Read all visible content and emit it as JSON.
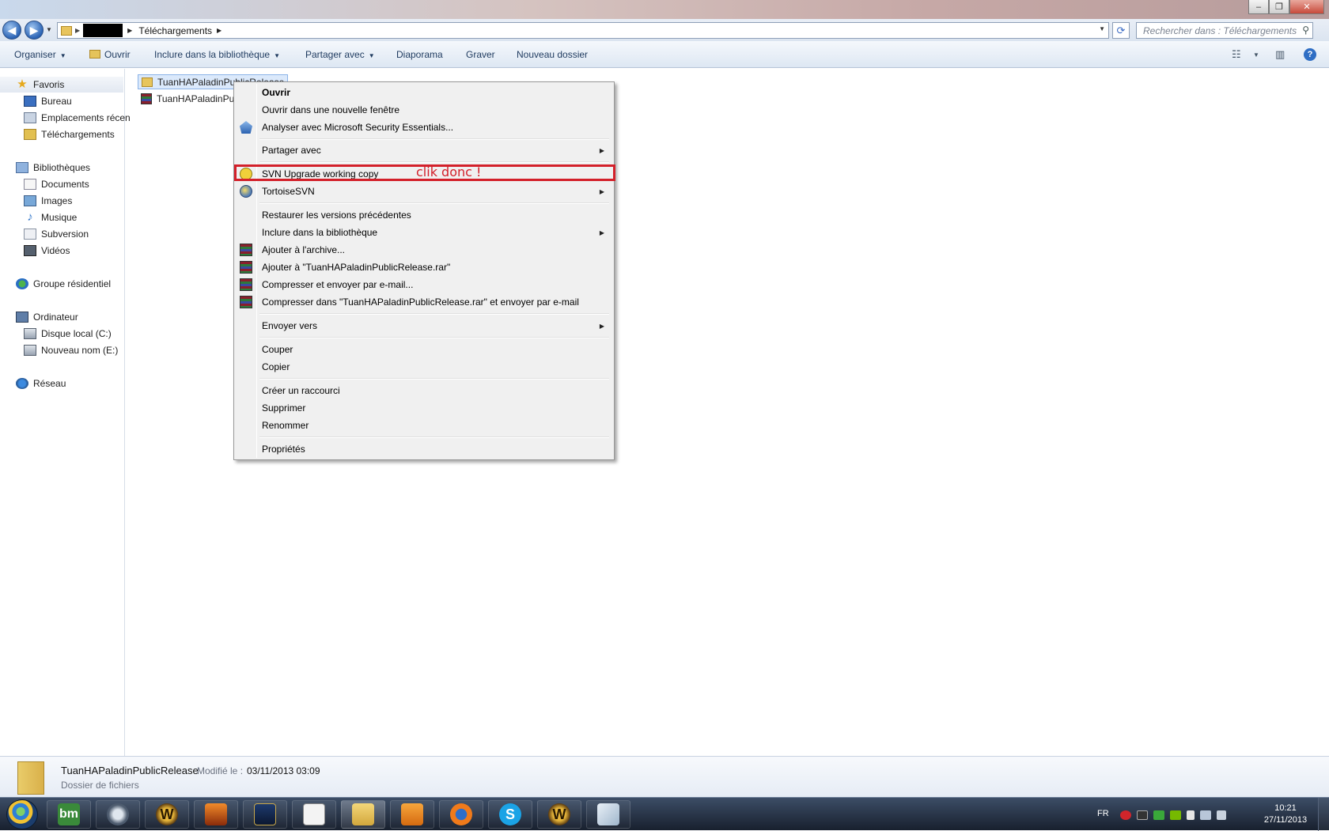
{
  "window": {
    "controls": [
      "–",
      "❐",
      "✕"
    ]
  },
  "address": {
    "location": "Téléchargements",
    "search_placeholder": "Rechercher dans : Téléchargements"
  },
  "toolbar": {
    "organiser": "Organiser",
    "ouvrir": "Ouvrir",
    "inclure": "Inclure dans la bibliothèque",
    "partager": "Partager avec",
    "diaporama": "Diaporama",
    "graver": "Graver",
    "nouveau_dossier": "Nouveau dossier"
  },
  "nav": {
    "favoris": "Favoris",
    "bureau": "Bureau",
    "emplacements": "Emplacements récen",
    "telechargements": "Téléchargements",
    "bibliotheques": "Bibliothèques",
    "documents": "Documents",
    "images": "Images",
    "musique": "Musique",
    "subversion": "Subversion",
    "videos": "Vidéos",
    "groupe": "Groupe résidentiel",
    "ordinateur": "Ordinateur",
    "disque_c": "Disque local (C:)",
    "nouveau_e": "Nouveau nom (E:)",
    "reseau": "Réseau"
  },
  "files": [
    {
      "name": "TuanHAPaladinPublicRelease",
      "type": "folder"
    },
    {
      "name": "TuanHAPaladinPul",
      "type": "rar"
    }
  ],
  "context_menu": {
    "ouvrir": "Ouvrir",
    "nouvelle_fenetre": "Ouvrir dans une nouvelle fenêtre",
    "analyser": "Analyser avec Microsoft Security Essentials...",
    "partager": "Partager avec",
    "svn_upgrade": "SVN Upgrade working copy",
    "tortoise": "TortoiseSVN",
    "restaurer": "Restaurer les versions précédentes",
    "inclure": "Inclure dans la bibliothèque",
    "ajouter_archive": "Ajouter à l'archive...",
    "ajouter_rar": "Ajouter à \"TuanHAPaladinPublicRelease.rar\"",
    "compresser_email": "Compresser et envoyer par e-mail...",
    "compresser_rar_email": "Compresser dans \"TuanHAPaladinPublicRelease.rar\" et envoyer par e-mail",
    "envoyer": "Envoyer vers",
    "couper": "Couper",
    "copier": "Copier",
    "raccourci": "Créer un raccourci",
    "supprimer": "Supprimer",
    "renommer": "Renommer",
    "proprietes": "Propriétés"
  },
  "annotation": "clik donc !",
  "details": {
    "name": "TuanHAPaladinPublicRelease",
    "modified_label": "Modifié le :",
    "modified_value": "03/11/2013 03:09",
    "type": "Dossier de fichiers"
  },
  "taskbar": {
    "apps": [
      "bm",
      "W",
      "S"
    ],
    "lang": "FR",
    "time": "10:21",
    "date": "27/11/2013"
  }
}
